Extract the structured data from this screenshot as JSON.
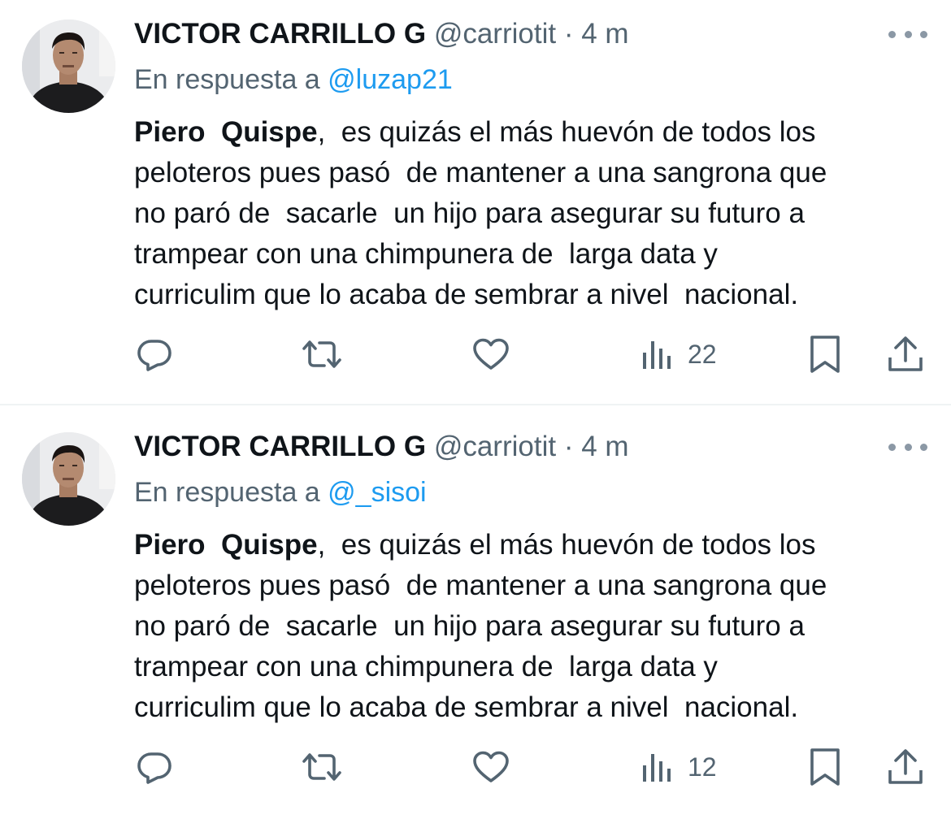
{
  "tweets": [
    {
      "author_name": "VICTOR CARRILLO G",
      "handle": "@carriotit",
      "separator": "·",
      "time": "4 m",
      "reply_prefix": "En respuesta a",
      "reply_to": "@luzap21",
      "text_bold": "Piero  Quispe",
      "text_lines": [
        ",  es quizás el más huevón de todos los",
        "peloteros pues pasó  de mantener a una sangrona que",
        "no paró de  sacarle  un hijo para asegurar su futuro a",
        "trampear con una chimpunera de  larga data y",
        "curriculim que lo acaba de sembrar a nivel  nacional."
      ],
      "views": "22",
      "icons": [
        "reply-icon",
        "retweet-icon",
        "like-icon",
        "views-icon",
        "bookmark-icon",
        "share-icon",
        "more-icon"
      ]
    },
    {
      "author_name": "VICTOR CARRILLO G",
      "handle": "@carriotit",
      "separator": "·",
      "time": "4 m",
      "reply_prefix": "En respuesta a",
      "reply_to": "@_sisoi",
      "text_bold": "Piero  Quispe",
      "text_lines": [
        ",  es quizás el más huevón de todos los",
        "peloteros pues pasó  de mantener a una sangrona que",
        "no paró de  sacarle  un hijo para asegurar su futuro a",
        "trampear con una chimpunera de  larga data y",
        "curriculim que lo acaba de sembrar a nivel  nacional."
      ],
      "views": "12",
      "icons": [
        "reply-icon",
        "retweet-icon",
        "like-icon",
        "views-icon",
        "bookmark-icon",
        "share-icon",
        "more-icon"
      ]
    }
  ],
  "colors": {
    "text": "#0f1419",
    "secondary": "#536471",
    "link": "#1d9bf0",
    "divider": "#eff3f4"
  }
}
